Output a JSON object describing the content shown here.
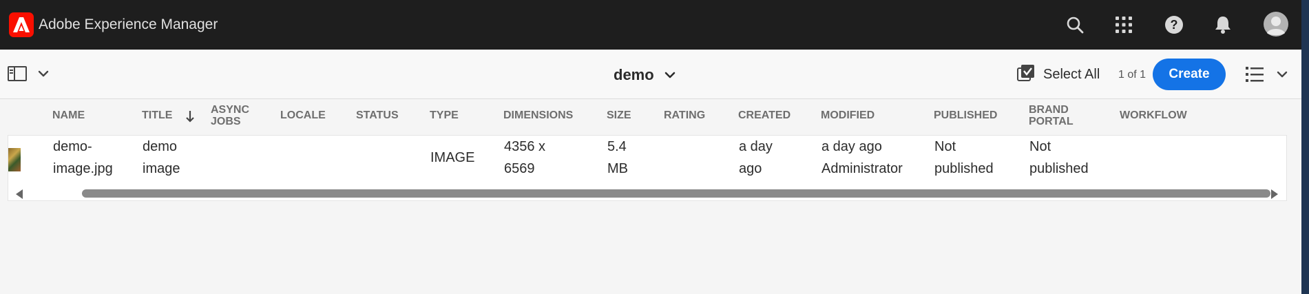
{
  "header": {
    "app_title": "Adobe Experience Manager",
    "icons": [
      "adobe-logo",
      "search-icon",
      "apps-grid-icon",
      "help-icon",
      "bell-icon",
      "avatar"
    ]
  },
  "toolbar": {
    "folder_title": "demo",
    "select_all_label": "Select All",
    "page_count": "1 of 1",
    "create_label": "Create"
  },
  "table": {
    "columns": [
      {
        "line1": "NAME",
        "line2": ""
      },
      {
        "line1": "TITLE",
        "line2": ""
      },
      {
        "line1": "ASYNC",
        "line2": "JOBS"
      },
      {
        "line1": "LOCALE",
        "line2": ""
      },
      {
        "line1": "STATUS",
        "line2": ""
      },
      {
        "line1": "TYPE",
        "line2": ""
      },
      {
        "line1": "DIMENSIONS",
        "line2": ""
      },
      {
        "line1": "SIZE",
        "line2": ""
      },
      {
        "line1": "RATING",
        "line2": ""
      },
      {
        "line1": "CREATED",
        "line2": ""
      },
      {
        "line1": "MODIFIED",
        "line2": ""
      },
      {
        "line1": "PUBLISHED",
        "line2": ""
      },
      {
        "line1": "BRAND",
        "line2": "PORTAL"
      },
      {
        "line1": "WORKFLOW",
        "line2": ""
      }
    ],
    "sort_column": "TITLE",
    "rows": [
      {
        "name": [
          "demo-",
          "image.jpg"
        ],
        "title": [
          "demo",
          "image"
        ],
        "type": "IMAGE",
        "dimensions": [
          "4356 x",
          "6569"
        ],
        "size": [
          "5.4",
          "MB"
        ],
        "created": [
          "a day",
          "ago"
        ],
        "modified": [
          "a day ago",
          "Administrator"
        ],
        "published": [
          "Not",
          "published"
        ],
        "brand_portal": [
          "Not",
          "published"
        ]
      }
    ]
  },
  "colors": {
    "topbar": "#1e1e1e",
    "accent": "#1473e6",
    "adobe_red": "#fa0f00"
  }
}
